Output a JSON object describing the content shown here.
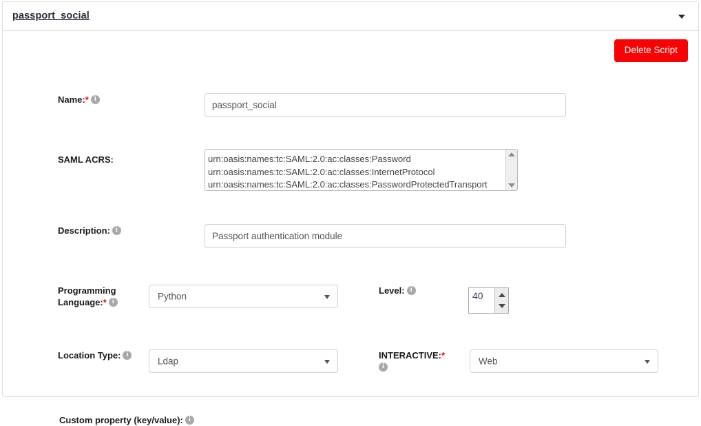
{
  "panel": {
    "title": "passport_social",
    "collapse_icon": "chevron-down-icon"
  },
  "actions": {
    "delete_label": "Delete Script",
    "delete_color": "#fb0202"
  },
  "fields": {
    "name": {
      "label": "Name:",
      "required": "*",
      "value": "passport_social",
      "info_icon": "info-icon"
    },
    "saml_acrs": {
      "label": "SAML ACRS:",
      "lines": [
        "urn:oasis:names:tc:SAML:2.0:ac:classes:Password",
        "urn:oasis:names:tc:SAML:2.0:ac:classes:InternetProtocol",
        "urn:oasis:names:tc:SAML:2.0:ac:classes:PasswordProtectedTransport"
      ],
      "line1": "urn:oasis:names:tc:SAML:2.0:ac:classes:Password",
      "line2": "urn:oasis:names:tc:SAML:2.0:ac:classes:InternetProtocol",
      "line3": "urn:oasis:names:tc:SAML:2.0:ac:classes:PasswordProtectedTransport"
    },
    "description": {
      "label": "Description:",
      "value": "Passport authentication module",
      "info_icon": "info-icon"
    },
    "programming_language": {
      "label_line1": "Programming",
      "label_line2": "Language:",
      "required": "*",
      "value": "Python",
      "info_icon": "info-icon"
    },
    "level": {
      "label": "Level:",
      "value": "40",
      "info_icon": "info-icon"
    },
    "location_type": {
      "label": "Location Type:",
      "value": "Ldap",
      "info_icon": "info-icon"
    },
    "interactive": {
      "label": "INTERACTIVE:",
      "required": "*",
      "value": "Web",
      "info_icon": "info-icon"
    },
    "custom_property": {
      "label": "Custom property (key/value):",
      "info_icon": "info-icon"
    }
  }
}
